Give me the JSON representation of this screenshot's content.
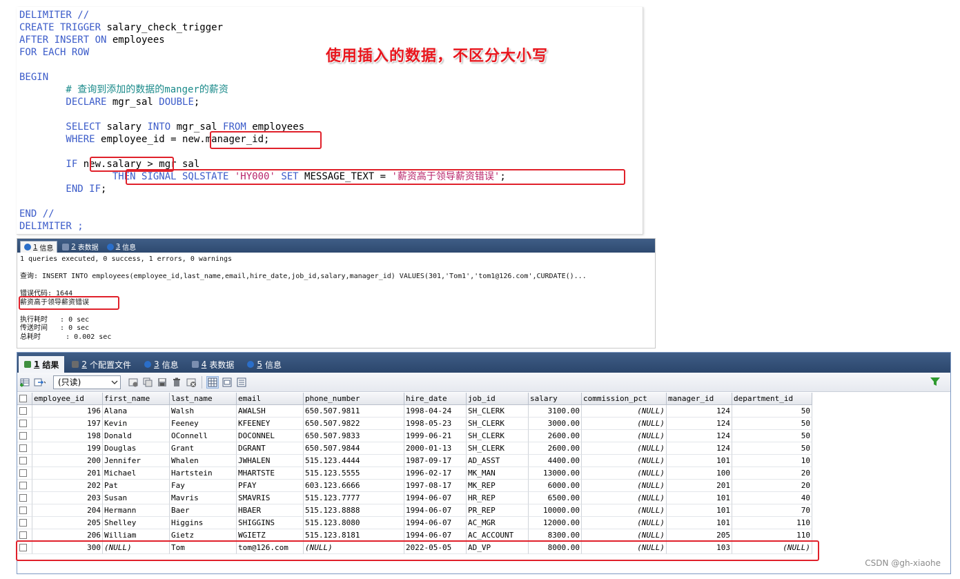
{
  "editor": {
    "lines": [
      [
        {
          "t": "DELIMITER //",
          "k": "kw"
        }
      ],
      [
        {
          "t": "CREATE TRIGGER ",
          "k": "kw"
        },
        {
          "t": "salary_check_trigger",
          "k": ""
        }
      ],
      [
        {
          "t": "AFTER INSERT ON ",
          "k": "kw"
        },
        {
          "t": "employees",
          "k": ""
        }
      ],
      [
        {
          "t": "FOR EACH ROW",
          "k": "kw"
        }
      ],
      [
        {
          "t": "",
          "k": ""
        }
      ],
      [
        {
          "t": "BEGIN",
          "k": "kw"
        }
      ],
      [
        {
          "t": "        # 查询到添加的数据的manger的薪资",
          "k": "cm"
        }
      ],
      [
        {
          "t": "        DECLARE ",
          "k": "kw"
        },
        {
          "t": "mgr_sal ",
          "k": ""
        },
        {
          "t": "DOUBLE",
          "k": "kw"
        },
        {
          "t": ";",
          "k": ""
        }
      ],
      [
        {
          "t": "",
          "k": ""
        }
      ],
      [
        {
          "t": "        SELECT ",
          "k": "kw"
        },
        {
          "t": "salary ",
          "k": ""
        },
        {
          "t": "INTO ",
          "k": "kw"
        },
        {
          "t": "mgr_sal ",
          "k": ""
        },
        {
          "t": "FROM ",
          "k": "kw"
        },
        {
          "t": "employees",
          "k": ""
        }
      ],
      [
        {
          "t": "        WHERE ",
          "k": "kw"
        },
        {
          "t": "employee_id = new.manager_id;",
          "k": ""
        }
      ],
      [
        {
          "t": "",
          "k": ""
        }
      ],
      [
        {
          "t": "        IF ",
          "k": "kw"
        },
        {
          "t": "new.salary > mgr_sal",
          "k": ""
        }
      ],
      [
        {
          "t": "                THEN SIGNAL SQLSTATE ",
          "k": "kw"
        },
        {
          "t": "'HY000' ",
          "k": "str"
        },
        {
          "t": "SET ",
          "k": "kw"
        },
        {
          "t": "MESSAGE_TEXT = ",
          "k": ""
        },
        {
          "t": "'薪资高于领导薪资错误'",
          "k": "str"
        },
        {
          "t": ";",
          "k": ""
        }
      ],
      [
        {
          "t": "        END IF",
          "k": "kw"
        },
        {
          "t": ";",
          "k": ""
        }
      ],
      [
        {
          "t": "",
          "k": ""
        }
      ],
      [
        {
          "t": "END //",
          "k": "kw"
        }
      ],
      [
        {
          "t": "DELIMITER ;",
          "k": "kw"
        }
      ]
    ],
    "annotation": "使用插入的数据，不区分大小写",
    "colors": {
      "keyword": "#3b5bc9",
      "comment": "#1a8a8a",
      "string": "#b8246a",
      "highlight": "#e0202a"
    }
  },
  "messages": {
    "tabs": [
      {
        "num": "1",
        "label": "信息",
        "icon": "info-icon"
      },
      {
        "num": "2",
        "label": "表数据",
        "icon": "table-icon"
      },
      {
        "num": "3",
        "label": "信息",
        "icon": "info-icon"
      }
    ],
    "lines": [
      "1 queries executed, 0 success, 1 errors, 0 warnings",
      "",
      "查询: INSERT INTO employees(employee_id,last_name,email,hire_date,job_id,salary,manager_id) VALUES(301,'Tom1','tom1@126.com',CURDATE()...",
      "",
      "错误代码: 1644",
      "薪资高于领导薪资错误",
      "",
      "执行耗时   : 0 sec",
      "传送时间   : 0 sec",
      "总耗时      : 0.002 sec"
    ]
  },
  "results": {
    "tabs": [
      {
        "num": "1",
        "label": "结果",
        "icon": "result-icon"
      },
      {
        "num": "2",
        "label": "个配置文件",
        "icon": "profile-icon"
      },
      {
        "num": "3",
        "label": "信息",
        "icon": "info-icon"
      },
      {
        "num": "4",
        "label": "表数据",
        "icon": "table-icon"
      },
      {
        "num": "5",
        "label": "信息",
        "icon": "info-icon"
      }
    ],
    "readonly_label": "(只读)",
    "columns": [
      "employee_id",
      "first_name",
      "last_name",
      "email",
      "phone_number",
      "hire_date",
      "job_id",
      "salary",
      "commission_pct",
      "manager_id",
      "department_id"
    ],
    "rows": [
      [
        "196",
        "Alana",
        "Walsh",
        "AWALSH",
        "650.507.9811",
        "1998-04-24",
        "SH_CLERK",
        "3100.00",
        "(NULL)",
        "124",
        "50"
      ],
      [
        "197",
        "Kevin",
        "Feeney",
        "KFEENEY",
        "650.507.9822",
        "1998-05-23",
        "SH_CLERK",
        "3000.00",
        "(NULL)",
        "124",
        "50"
      ],
      [
        "198",
        "Donald",
        "OConnell",
        "DOCONNEL",
        "650.507.9833",
        "1999-06-21",
        "SH_CLERK",
        "2600.00",
        "(NULL)",
        "124",
        "50"
      ],
      [
        "199",
        "Douglas",
        "Grant",
        "DGRANT",
        "650.507.9844",
        "2000-01-13",
        "SH_CLERK",
        "2600.00",
        "(NULL)",
        "124",
        "50"
      ],
      [
        "200",
        "Jennifer",
        "Whalen",
        "JWHALEN",
        "515.123.4444",
        "1987-09-17",
        "AD_ASST",
        "4400.00",
        "(NULL)",
        "101",
        "10"
      ],
      [
        "201",
        "Michael",
        "Hartstein",
        "MHARTSTE",
        "515.123.5555",
        "1996-02-17",
        "MK_MAN",
        "13000.00",
        "(NULL)",
        "100",
        "20"
      ],
      [
        "202",
        "Pat",
        "Fay",
        "PFAY",
        "603.123.6666",
        "1997-08-17",
        "MK_REP",
        "6000.00",
        "(NULL)",
        "201",
        "20"
      ],
      [
        "203",
        "Susan",
        "Mavris",
        "SMAVRIS",
        "515.123.7777",
        "1994-06-07",
        "HR_REP",
        "6500.00",
        "(NULL)",
        "101",
        "40"
      ],
      [
        "204",
        "Hermann",
        "Baer",
        "HBAER",
        "515.123.8888",
        "1994-06-07",
        "PR_REP",
        "10000.00",
        "(NULL)",
        "101",
        "70"
      ],
      [
        "205",
        "Shelley",
        "Higgins",
        "SHIGGINS",
        "515.123.8080",
        "1994-06-07",
        "AC_MGR",
        "12000.00",
        "(NULL)",
        "101",
        "110"
      ],
      [
        "206",
        "William",
        "Gietz",
        "WGIETZ",
        "515.123.8181",
        "1994-06-07",
        "AC_ACCOUNT",
        "8300.00",
        "(NULL)",
        "205",
        "110"
      ],
      [
        "300",
        "(NULL)",
        "Tom",
        "tom@126.com",
        "(NULL)",
        "2022-05-05",
        "AD_VP",
        "8000.00",
        "(NULL)",
        "103",
        "(NULL)"
      ]
    ]
  },
  "watermark": "CSDN @gh-xiaohe"
}
